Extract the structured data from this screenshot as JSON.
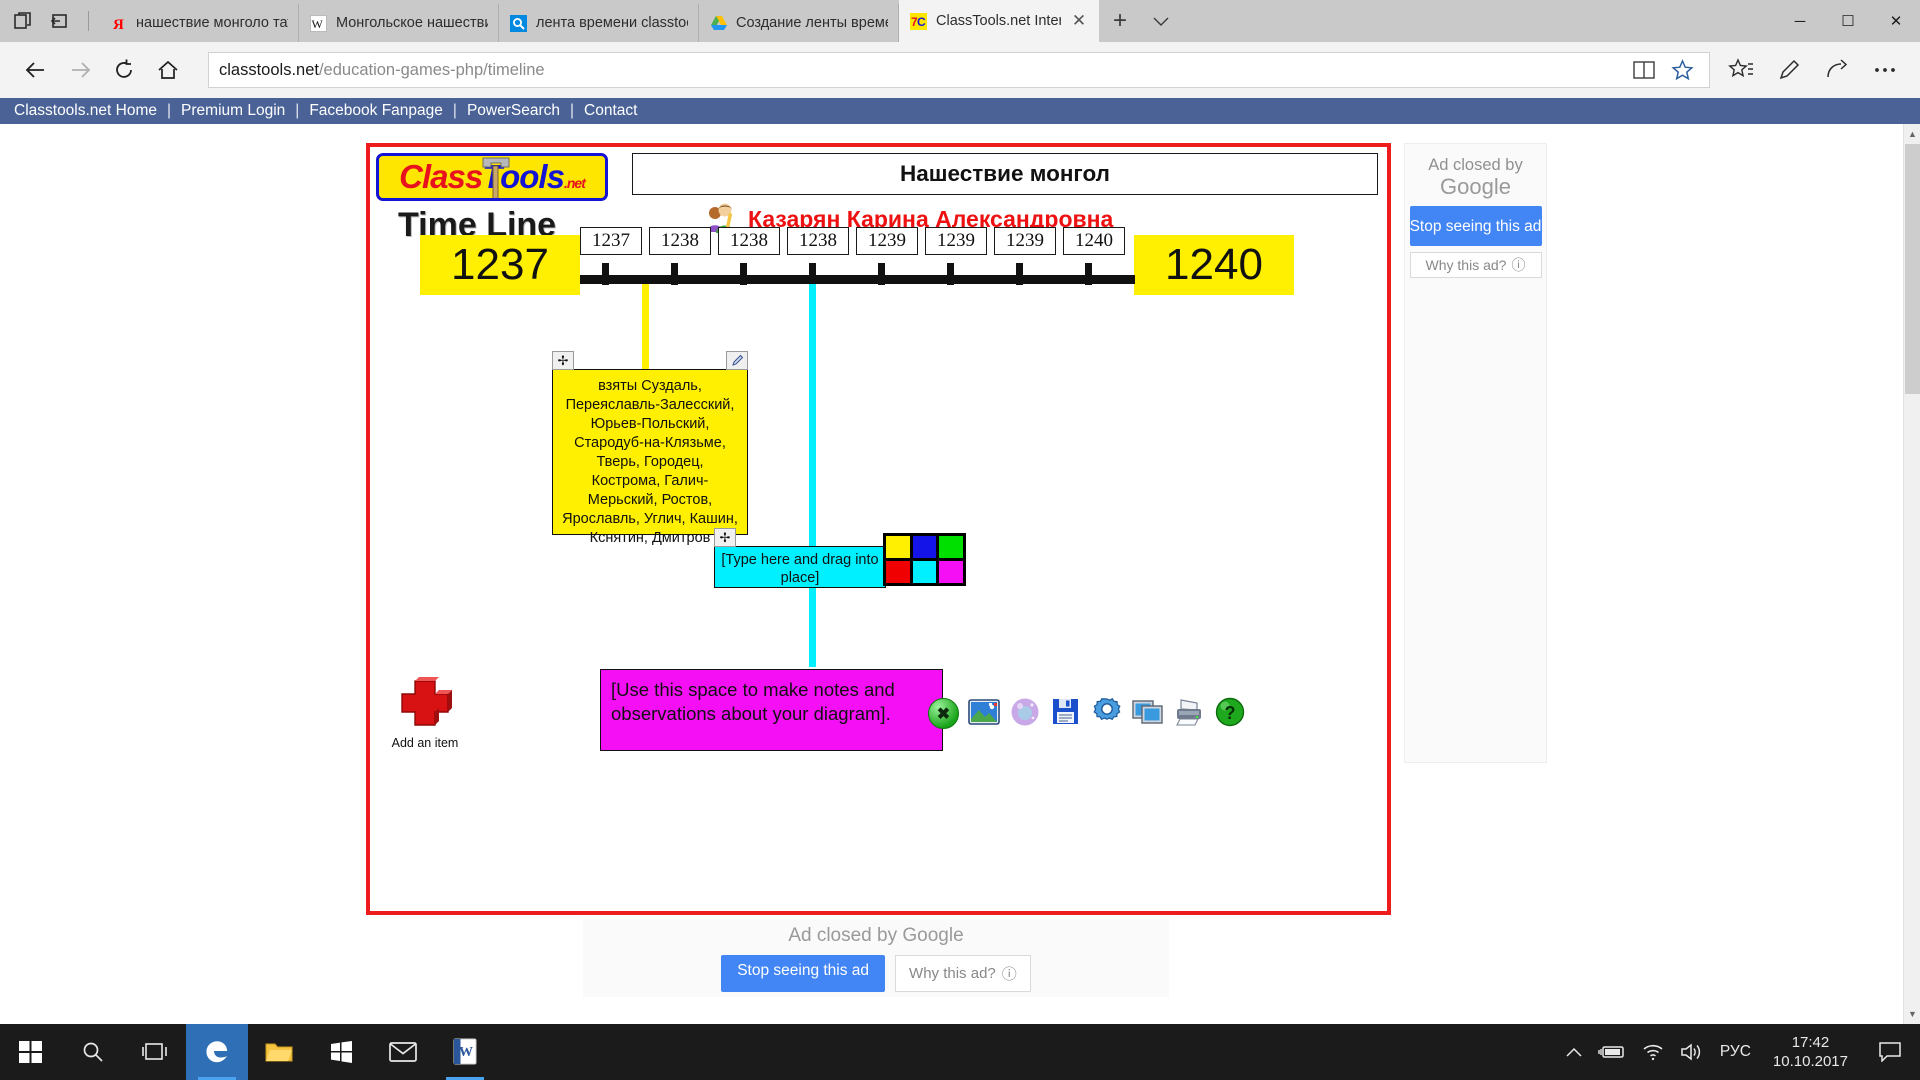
{
  "browser": {
    "tabs": [
      {
        "label": "нашествие монголо татар ",
        "favicon": "yandex-icon",
        "active": false
      },
      {
        "label": "Монгольское нашествие н",
        "favicon": "wikipedia-icon",
        "active": false
      },
      {
        "label": "лента времени classtools -",
        "favicon": "search-icon",
        "active": false
      },
      {
        "label": "Создание ленты времени в",
        "favicon": "google-drive-icon",
        "active": false
      },
      {
        "label": "ClassTools.net Interactiv",
        "favicon": "classtools-icon",
        "active": true
      }
    ],
    "new_tab_label": "+",
    "url_host": "classtools.net",
    "url_path": "/education-games-php/timeline",
    "window_controls": {
      "minimize": "─",
      "maximize": "☐",
      "close": "✕"
    }
  },
  "sitenav": {
    "items": [
      "Classtools.net Home",
      "Premium Login",
      "Facebook Fanpage",
      "PowerSearch",
      "Contact"
    ],
    "separator": "|"
  },
  "timeline": {
    "logo": {
      "class_text": "Class",
      "tools_text": "Tools",
      "net_text": ".net"
    },
    "app_name": "Time Line",
    "title": "Нашествие монгол",
    "author": "Казарян Карина Александровна",
    "start_year": "1237",
    "end_year": "1240",
    "date_labels": [
      "1237",
      "1238",
      "1238",
      "1238",
      "1239",
      "1239",
      "1239",
      "1240"
    ],
    "notes": [
      {
        "id": "yellow-note",
        "color": "#ffef00",
        "text": "взяты Суздаль, Переяславль-Залесский, Юрьев-Польский, Стародуб-на-Клязьме, Тверь, Городец, Кострома, Галич-Мерьский, Ростов, Ярославль, Углич, Кашин, Кснятин, Дмитров",
        "handle": "move-handle",
        "edit": "pencil-edit"
      },
      {
        "id": "cyan-note",
        "color": "#00f0ff",
        "text": "[Type here and drag into place]",
        "handle": "move-handle"
      }
    ],
    "palette_colors": [
      "#ffef00",
      "#1414e8",
      "#00e000",
      "#f00000",
      "#00f0ff",
      "#f50ff5"
    ],
    "observations_text": "[Use this space to make notes and observations about your diagram].",
    "observations_color": "#f50ff5",
    "add_item_label": "Add an item",
    "toolbar_icons": [
      "image-icon",
      "crystal-ball-icon",
      "save-floppy-icon",
      "gear-settings-icon",
      "windows-screens-icon",
      "printer-icon",
      "help-question-icon"
    ],
    "close_button_glyph": "✖"
  },
  "ads": {
    "side": {
      "closed_text_line1": "Ad closed by",
      "closed_text_line2": "Google",
      "stop_button": "Stop seeing this ad",
      "why_button": "Why this ad?",
      "info_glyph": "ⓘ"
    },
    "bottom": {
      "closed_text": "Ad closed by",
      "google_text": "Google",
      "stop_button": "Stop seeing this ad",
      "why_button": "Why this ad?",
      "info_glyph": "ⓘ"
    }
  },
  "taskbar": {
    "start": "windows-start-icon",
    "items": [
      "search-icon",
      "task-view-icon",
      "edge-browser-icon",
      "file-explorer-icon",
      "microsoft-store-icon",
      "mail-icon",
      "word-icon"
    ],
    "tray": {
      "chevron": "⌃",
      "battery": "battery-charging-icon",
      "wifi": "wifi-icon",
      "volume": "volume-icon",
      "language": "РУС",
      "time": "17:42",
      "date": "10.10.2017",
      "action_center": "action-center-icon"
    }
  }
}
